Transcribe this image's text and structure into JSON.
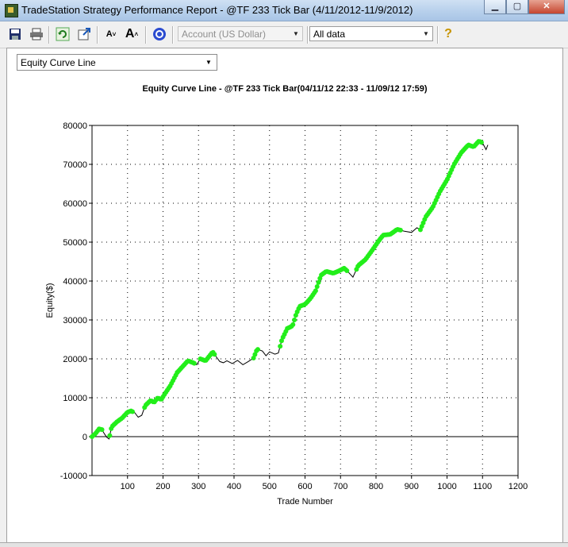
{
  "window": {
    "title": "TradeStation Strategy Performance Report - @TF 233 Tick Bar (4/11/2012-11/9/2012)"
  },
  "toolbar": {
    "account_placeholder": "Account (US Dollar)",
    "data_range": "All data",
    "buttons": [
      "save-icon",
      "print-icon",
      "refresh-icon",
      "export-icon",
      "decrease-font-icon",
      "increase-font-icon",
      "target-icon",
      "help-icon"
    ]
  },
  "view_selector": "Equity Curve Line",
  "chart_data": {
    "type": "line",
    "title": "Equity Curve Line - @TF 233 Tick Bar(04/11/12 22:33 - 11/09/12 17:59)",
    "xlabel": "Trade Number",
    "ylabel": "Equity($)",
    "xlim": [
      0,
      1200
    ],
    "ylim": [
      -10000,
      80000
    ],
    "xticks": [
      100,
      200,
      300,
      400,
      500,
      600,
      700,
      800,
      900,
      1000,
      1100,
      1200
    ],
    "yticks": [
      -10000,
      0,
      10000,
      20000,
      30000,
      40000,
      50000,
      60000,
      70000,
      80000
    ],
    "x_tick_labels": [
      "100",
      "200",
      "300",
      "400",
      "500",
      "600",
      "700",
      "800",
      "900",
      "1000",
      "1100",
      "1200"
    ],
    "y_tick_labels": [
      "-10000",
      "0",
      "10000",
      "20000",
      "30000",
      "40000",
      "50000",
      "60000",
      "70000",
      "80000"
    ],
    "grid": true,
    "series": [
      {
        "points": [
          [
            0,
            0
          ],
          [
            10,
            800
          ],
          [
            20,
            2000
          ],
          [
            28,
            1800
          ],
          [
            35,
            700
          ],
          [
            42,
            -200
          ],
          [
            48,
            -600
          ],
          [
            55,
            2500
          ],
          [
            70,
            3800
          ],
          [
            85,
            4800
          ],
          [
            100,
            6300
          ],
          [
            110,
            6600
          ],
          [
            120,
            6200
          ],
          [
            130,
            5000
          ],
          [
            140,
            5500
          ],
          [
            150,
            8000
          ],
          [
            165,
            9300
          ],
          [
            175,
            8800
          ],
          [
            185,
            10000
          ],
          [
            195,
            9500
          ],
          [
            205,
            11000
          ],
          [
            220,
            13000
          ],
          [
            240,
            16500
          ],
          [
            255,
            18000
          ],
          [
            270,
            19500
          ],
          [
            285,
            19000
          ],
          [
            295,
            18500
          ],
          [
            305,
            20000
          ],
          [
            320,
            19500
          ],
          [
            340,
            21800
          ],
          [
            350,
            20500
          ],
          [
            360,
            19300
          ],
          [
            370,
            19000
          ],
          [
            380,
            19500
          ],
          [
            395,
            18800
          ],
          [
            410,
            19600
          ],
          [
            425,
            18500
          ],
          [
            440,
            19300
          ],
          [
            455,
            20200
          ],
          [
            465,
            22500
          ],
          [
            480,
            22000
          ],
          [
            490,
            20800
          ],
          [
            500,
            21800
          ],
          [
            515,
            21200
          ],
          [
            525,
            21500
          ],
          [
            535,
            25000
          ],
          [
            550,
            27800
          ],
          [
            565,
            28500
          ],
          [
            575,
            31500
          ],
          [
            585,
            33500
          ],
          [
            600,
            34000
          ],
          [
            615,
            35500
          ],
          [
            630,
            37500
          ],
          [
            645,
            41500
          ],
          [
            660,
            42500
          ],
          [
            680,
            42000
          ],
          [
            700,
            42800
          ],
          [
            710,
            43300
          ],
          [
            720,
            42500
          ],
          [
            735,
            41000
          ],
          [
            750,
            44000
          ],
          [
            770,
            45500
          ],
          [
            790,
            48000
          ],
          [
            805,
            50000
          ],
          [
            820,
            51800
          ],
          [
            840,
            52000
          ],
          [
            860,
            53300
          ],
          [
            880,
            52800
          ],
          [
            900,
            52500
          ],
          [
            915,
            53700
          ],
          [
            925,
            53200
          ],
          [
            940,
            56500
          ],
          [
            960,
            59000
          ],
          [
            980,
            63000
          ],
          [
            1000,
            66000
          ],
          [
            1020,
            70000
          ],
          [
            1040,
            73000
          ],
          [
            1060,
            75000
          ],
          [
            1075,
            74500
          ],
          [
            1090,
            76000
          ],
          [
            1100,
            75500
          ],
          [
            1110,
            73800
          ],
          [
            1115,
            75000
          ]
        ],
        "highlight_ranges": [
          [
            0,
            28
          ],
          [
            50,
            115
          ],
          [
            148,
            240
          ],
          [
            240,
            290
          ],
          [
            305,
            345
          ],
          [
            455,
            470
          ],
          [
            530,
            720
          ],
          [
            745,
            870
          ],
          [
            925,
            1100
          ]
        ]
      }
    ],
    "colors": {
      "line": "#000000",
      "highlight": "#22ee1a"
    }
  }
}
